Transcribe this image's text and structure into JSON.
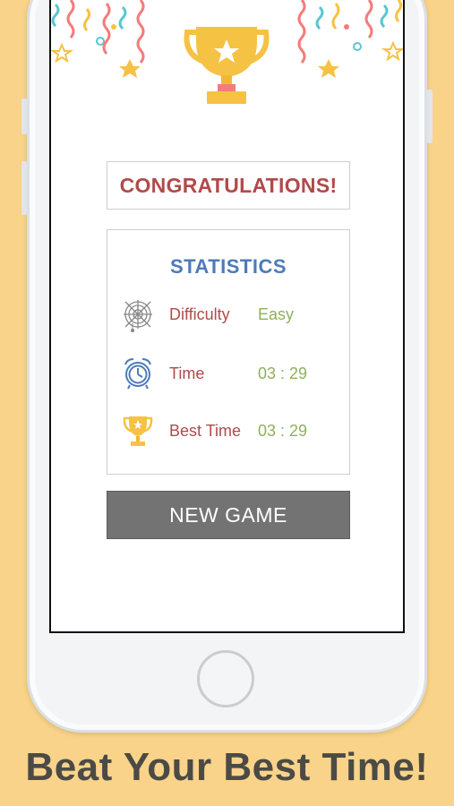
{
  "colors": {
    "background": "#f8d389",
    "congrats_text": "#b04a4a",
    "stats_title": "#4e7bb8",
    "label": "#b04a4a",
    "value": "#8fb05a",
    "button_bg": "#737373",
    "trophy": "#f6c244"
  },
  "header": {
    "congrats": "CONGRATULATIONS!"
  },
  "statistics": {
    "title": "STATISTICS",
    "rows": [
      {
        "icon": "spiderweb-icon",
        "label": "Difficulty",
        "value": "Easy"
      },
      {
        "icon": "alarm-clock-icon",
        "label": "Time",
        "value": "03 : 29"
      },
      {
        "icon": "trophy-icon",
        "label": "Best Time",
        "value": "03 : 29"
      }
    ]
  },
  "actions": {
    "new_game": "NEW GAME"
  },
  "caption": "Beat Your Best Time!"
}
